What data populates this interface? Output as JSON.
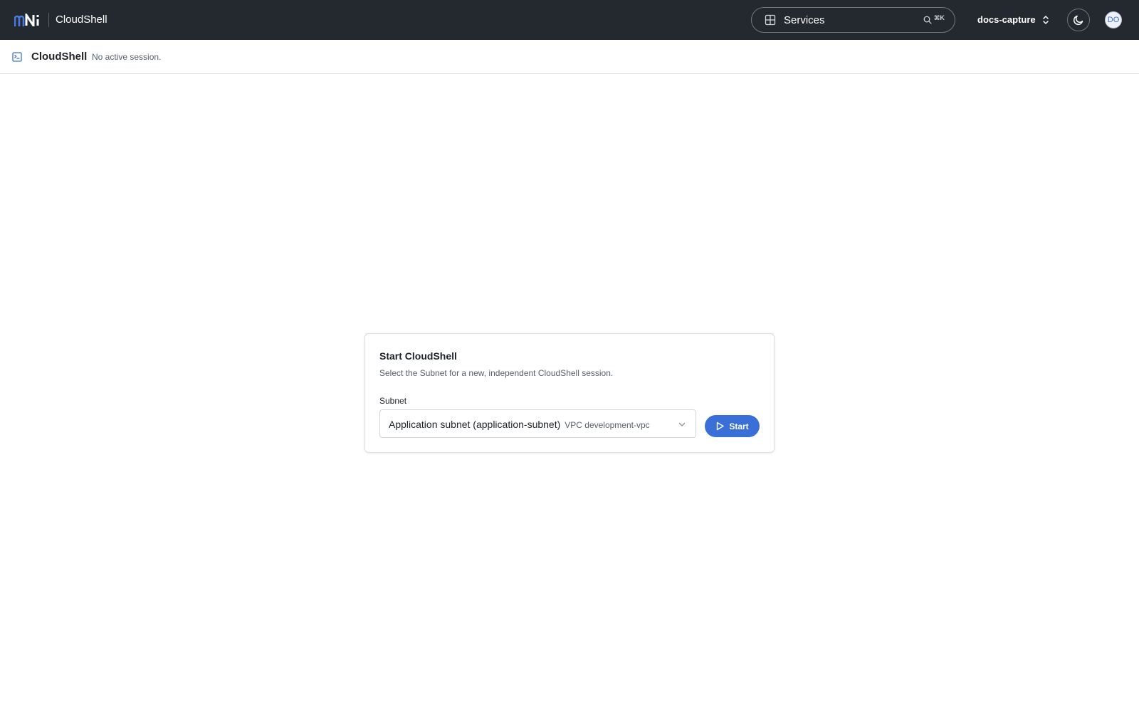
{
  "colors": {
    "topbar_bg": "#24292f",
    "accent": "#3b6fd8",
    "logo_blue": "#4a7be0"
  },
  "topbar": {
    "logo_text": "mNi",
    "app_title": "CloudShell",
    "services_label": "Services",
    "services_shortcut": "⌘K",
    "project_name": "docs-capture",
    "avatar_initials": "DO",
    "icons": {
      "services": "grid-icon",
      "search": "search-icon",
      "project": "chevron-up-down-icon",
      "theme": "moon-icon"
    }
  },
  "subheader": {
    "title": "CloudShell",
    "status": "No active session.",
    "icon": "terminal-icon"
  },
  "card": {
    "title": "Start CloudShell",
    "description": "Select the Subnet for a new, independent CloudShell session.",
    "subnet_label": "Subnet",
    "subnet_value": "Application subnet (application-subnet)",
    "subnet_vpc": "VPC development-vpc",
    "start_label": "Start"
  }
}
